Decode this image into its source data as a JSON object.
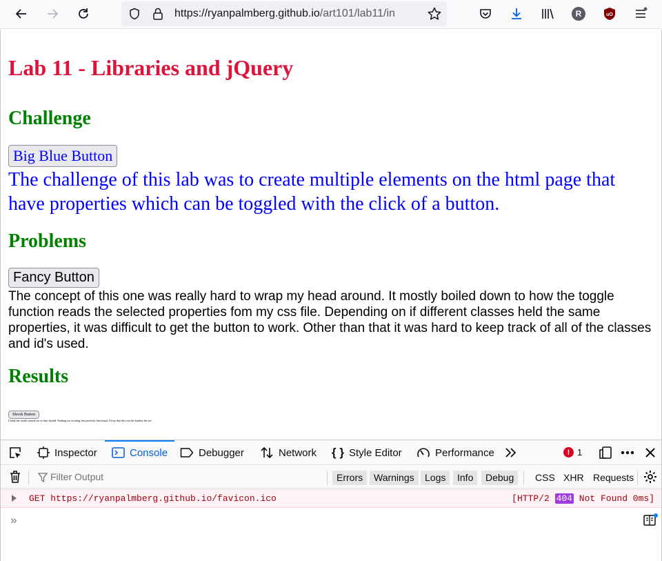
{
  "browser": {
    "url_host": "https://ryanpalmberg.github.io",
    "url_path": "/art101/lab11/in",
    "profile_initial": "R"
  },
  "page": {
    "title": "Lab 11 - Libraries and jQuery",
    "sections": {
      "challenge": {
        "heading": "Challenge",
        "button_label": "Big Blue Button",
        "text": "The challenge of this lab was to create multiple elements on the html page that have properties which can be toggled with the click of a button."
      },
      "problems": {
        "heading": "Problems",
        "button_label": "Fancy Button",
        "text": "The concept of this one was really hard to wrap my head around. It mostly boiled down to how the toggle function reads the selected properties fom my css file. Depending on if different classes held the same properties, it was difficult to get the button to work. Other than that it was hard to keep track of all of the classes and id's used."
      },
      "results": {
        "heading": "Results",
        "button_label": "Shook Button",
        "text": "I think the results turned out as they should. Nothing too exciting, but perfectly functional. I'd say that this was the hardest lab yet."
      }
    }
  },
  "devtools": {
    "tabs": [
      "Inspector",
      "Console",
      "Debugger",
      "Network",
      "Style Editor",
      "Performance"
    ],
    "active_tab": "Console",
    "error_count": "1",
    "filter_placeholder": "Filter Output",
    "filter_buttons": [
      "Errors",
      "Warnings",
      "Logs",
      "Info",
      "Debug"
    ],
    "type_filters": [
      "CSS",
      "XHR",
      "Requests"
    ],
    "console_messages": [
      {
        "text": "GET https://ryanpalmberg.github.io/favicon.ico",
        "status_prefix": "[HTTP/2",
        "status_code": "404",
        "status_suffix": "Not Found 0ms]"
      }
    ],
    "prompt_symbol": "»"
  },
  "colors": {
    "title": "#dc143c",
    "heading": "#008000",
    "challenge_text": "#0000ff",
    "active_tab": "#0060df",
    "error": "#d70022"
  }
}
